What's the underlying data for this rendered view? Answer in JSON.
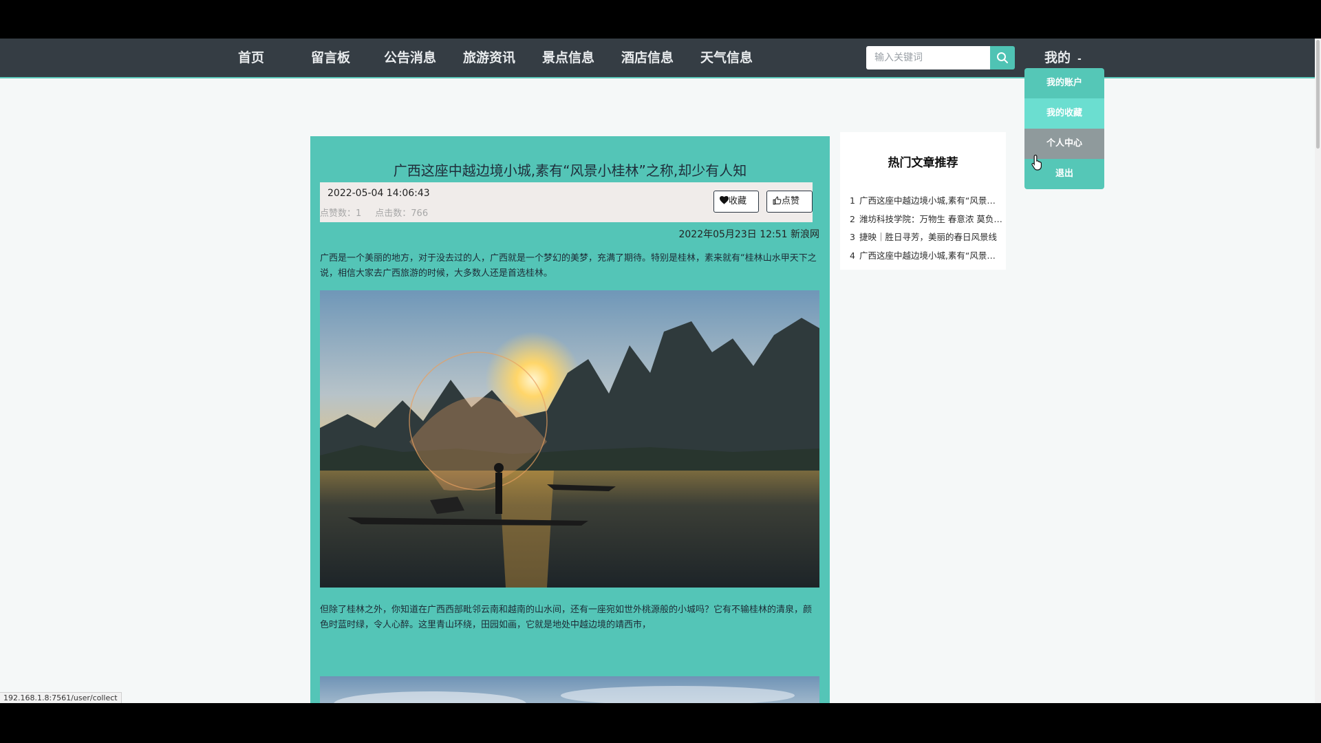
{
  "nav": {
    "items": [
      {
        "label": "首页"
      },
      {
        "label": "留言板"
      },
      {
        "label": "公告消息"
      },
      {
        "label": "旅游资讯"
      },
      {
        "label": "景点信息"
      },
      {
        "label": "酒店信息"
      },
      {
        "label": "天气信息"
      }
    ],
    "search_placeholder": "输入关键词",
    "search_icon": "search-icon",
    "mine_label": "我的",
    "mine_caret": "-"
  },
  "dropdown": {
    "items": [
      {
        "label": "我的账户"
      },
      {
        "label": "我的收藏"
      },
      {
        "label": "个人中心"
      },
      {
        "label": "退出"
      }
    ],
    "highlighted": "我的收藏",
    "active": "个人中心"
  },
  "article": {
    "title": "广西这座中越边境小城,素有“风景小桂林”之称,却少有人知",
    "datetime": "2022-05-04 14:06:43",
    "like_count_label": "点赞数：1",
    "click_count_label": "点击数：766",
    "favorite_label": "收藏",
    "like_label": "点赞",
    "source_line": "2022年05月23日 12:51 新浪网",
    "paragraph1": "广西是一个美丽的地方，对于没去过的人，广西就是一个梦幻的美梦，充满了期待。特别是桂林，素来就有“桂林山水甲天下之说，相信大家去广西旅游的时候，大多数人还是首选桂林。",
    "paragraph2": "但除了桂林之外，你知道在广西西部毗邻云南和越南的山水间，还有一座宛如世外桃源般的小城吗？它有不输桂林的清泉，颜色时蓝时绿，令人心醉。这里青山环绕，田园如画，它就是地处中越边境的靖西市，"
  },
  "hot": {
    "title": "热门文章推荐",
    "items": [
      {
        "num": "1",
        "text": "广西这座中越边境小城,素有“风景小桂林”之称,却少有人知"
      },
      {
        "num": "2",
        "text": "潍坊科技学院：万物生 春意浓 莫负好春光"
      },
      {
        "num": "3",
        "text": "捷映｜胜日寻芳，美丽的春日风景线"
      },
      {
        "num": "4",
        "text": "广西这座中越边境小城,素有“风景小桂林”之称"
      }
    ]
  },
  "status_url": "192.168.1.8:7561/user/collect",
  "colors": {
    "nav_bg": "#353d44",
    "accent": "#55c7b7",
    "page_bg": "#f5f8f8"
  }
}
